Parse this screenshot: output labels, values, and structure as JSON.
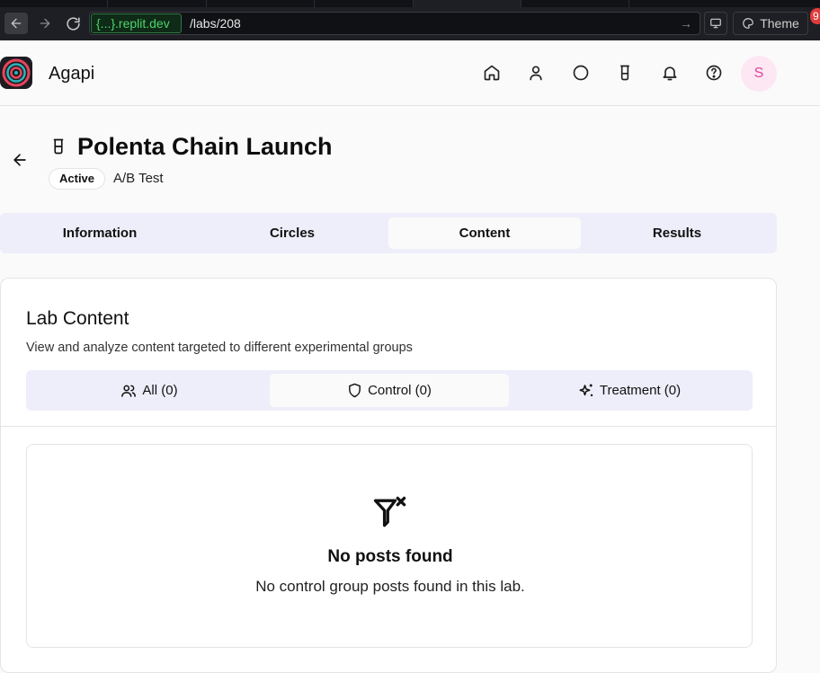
{
  "browser": {
    "url_host": "{...}.replit.dev",
    "url_path": "/labs/208",
    "theme_label": "Theme",
    "notification_count": "9"
  },
  "app": {
    "name": "Agapi",
    "avatar_initial": "S",
    "nav_icons": [
      "home-icon",
      "user-icon",
      "circle-icon",
      "beaker-icon",
      "bell-icon",
      "help-icon"
    ]
  },
  "lab": {
    "title": "Polenta Chain Launch",
    "status": "Active",
    "type": "A/B Test"
  },
  "tabs": [
    {
      "label": "Information"
    },
    {
      "label": "Circles"
    },
    {
      "label": "Content",
      "active": true
    },
    {
      "label": "Results"
    }
  ],
  "content": {
    "title": "Lab Content",
    "subtitle": "View and analyze content targeted to different experimental groups",
    "groups": [
      {
        "label": "All (0)",
        "icon": "users-icon"
      },
      {
        "label": "Control (0)",
        "icon": "shield-icon",
        "active": true
      },
      {
        "label": "Treatment (0)",
        "icon": "sparkles-icon"
      }
    ],
    "empty_title": "No posts found",
    "empty_text": "No control group posts found in this lab."
  }
}
